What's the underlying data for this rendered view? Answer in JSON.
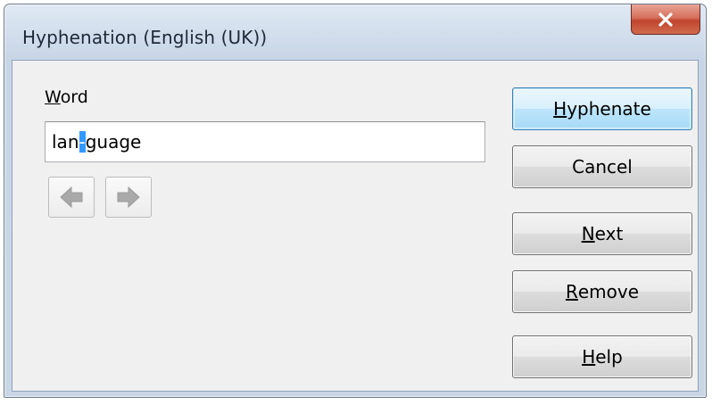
{
  "window": {
    "title": "Hyphenation (English (UK))",
    "close_label": "x"
  },
  "word": {
    "label_mnemonic": "W",
    "label_rest": "ord",
    "value_before": "lan",
    "value_selected": "-",
    "value_after": "guage"
  },
  "navigation": {
    "prev_icon": "arrow-left-icon",
    "next_icon": "arrow-right-icon",
    "enabled": false
  },
  "buttons": {
    "hyphenate": {
      "mnemonic": "H",
      "rest": "yphenate"
    },
    "cancel": {
      "label": "Cancel"
    },
    "next": {
      "mnemonic": "N",
      "rest": "ext"
    },
    "remove": {
      "mnemonic": "R",
      "rest": "emove"
    },
    "help": {
      "mnemonic": "H",
      "rest": "elp"
    }
  },
  "colors": {
    "selection": "#3399ff",
    "close_button": "#c7472e",
    "default_button_border": "#3c7fb1"
  }
}
